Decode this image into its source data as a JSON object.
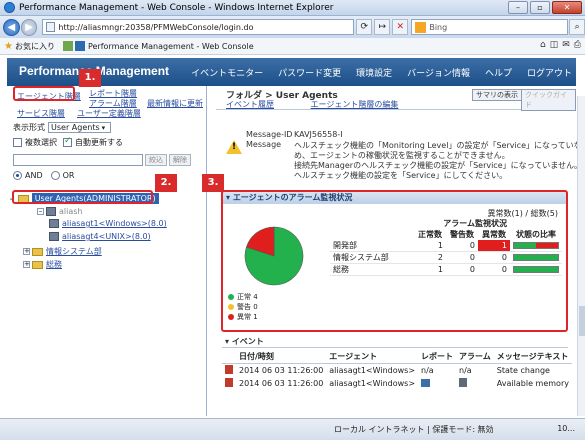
{
  "window": {
    "title": "Performance Management - Web Console - Windows Internet Explorer",
    "buttons": [
      "–",
      "▫",
      "✕"
    ]
  },
  "browser": {
    "url": "http://aliasmngr:20358/PFMWebConsole/login.do",
    "search_placeholder": "Bing",
    "favorites_label": "お気に入り",
    "tab_title": "Performance Management - Web Console"
  },
  "app": {
    "brand": "Performance Management",
    "menu": [
      "イベントモニター",
      "パスワード変更",
      "環境設定",
      "バージョン情報",
      "ヘルプ",
      "ログアウト"
    ]
  },
  "left": {
    "tabs": [
      "エージェント階層",
      "レポート階層",
      "アラーム階層",
      "最新情報に更新",
      "サービス階層",
      "ユーザー定義階層"
    ],
    "display_format_label": "表示形式",
    "display_format_value": "User Agents",
    "multi_select_label": "複数選択",
    "auto_update_label": "自動更新する",
    "narrow_btn": "絞込",
    "clear_btn": "解除",
    "and_label": "AND",
    "or_label": "OR",
    "tree": {
      "root": "User Agents(ADMINISTRATOR)",
      "host_partial": "aliash",
      "agent1": "aliasagt1<Windows>(8.0)",
      "agent2": "aliasagt4<UNIX>(8.0)",
      "folder1": "情報システム部",
      "folder2": "総務"
    }
  },
  "callouts": [
    "1.",
    "2.",
    "3."
  ],
  "right": {
    "breadcrumb": "フォルダ > User Agents",
    "links": [
      "イベント履歴",
      "エージェント階層の編集"
    ],
    "buttons": [
      "サマリの表示",
      "クイックガイド"
    ],
    "message": {
      "id_label": "Message-ID",
      "id_value": "KAVJ56558-I",
      "message_label": "Message",
      "lines": [
        "ヘルスチェック機能の「Monitoring Level」の設定が「Service」になっていないた",
        "め、エージェントの稼働状況を監視することができません。",
        "接続先Managerのヘルスチェック機能の設定が「Service」になっていません。",
        "ヘルスチェック機能の設定を「Service」にしてください。"
      ]
    },
    "alarm_panel": {
      "title": "エージェントのアラーム監視状況",
      "count_text": "異常数(1) / 総数(5)",
      "header_group": "アラーム監視状況",
      "columns": [
        "正常数",
        "警告数",
        "異常数",
        "状態の比率"
      ],
      "rows": [
        {
          "name": "開発部",
          "normal": "1",
          "warning": "0",
          "abnormal": "1",
          "ratio_normal": 0.5
        },
        {
          "name": "情報システム部",
          "normal": "2",
          "warning": "0",
          "abnormal": "0",
          "ratio_normal": 1.0
        },
        {
          "name": "総務",
          "normal": "1",
          "warning": "0",
          "abnormal": "0",
          "ratio_normal": 1.0
        }
      ],
      "legend": [
        {
          "label": "正常 4",
          "color": "#22b14c"
        },
        {
          "label": "警告 0",
          "color": "#f2c12e"
        },
        {
          "label": "異常 1",
          "color": "#e01e1e"
        }
      ]
    },
    "events": {
      "title": "イベント",
      "columns": [
        "",
        "日付/時刻",
        "エージェント",
        "レポート",
        "アラーム",
        "メッセージテキスト"
      ],
      "rows": [
        {
          "datetime": "2014 06 03 11:26:00",
          "agent": "aliasagt1<Windows>",
          "report": "n/a",
          "alarm": "n/a",
          "message": "State change"
        },
        {
          "datetime": "2014 06 03 11:26:00",
          "agent": "aliasagt1<Windows>",
          "report": "",
          "alarm": "",
          "message": "Available memory"
        }
      ]
    }
  },
  "status": {
    "zone": "ローカル イントラネット | 保護モード: 無効",
    "zoom": "10..."
  },
  "colors": {
    "accent": "#1c4f88",
    "callout": "#d92b2b",
    "normal": "#22b14c",
    "abnormal": "#e01e1e"
  },
  "chart_data": {
    "type": "pie",
    "categories": [
      "正常",
      "警告",
      "異常"
    ],
    "values": [
      4,
      0,
      1
    ]
  }
}
